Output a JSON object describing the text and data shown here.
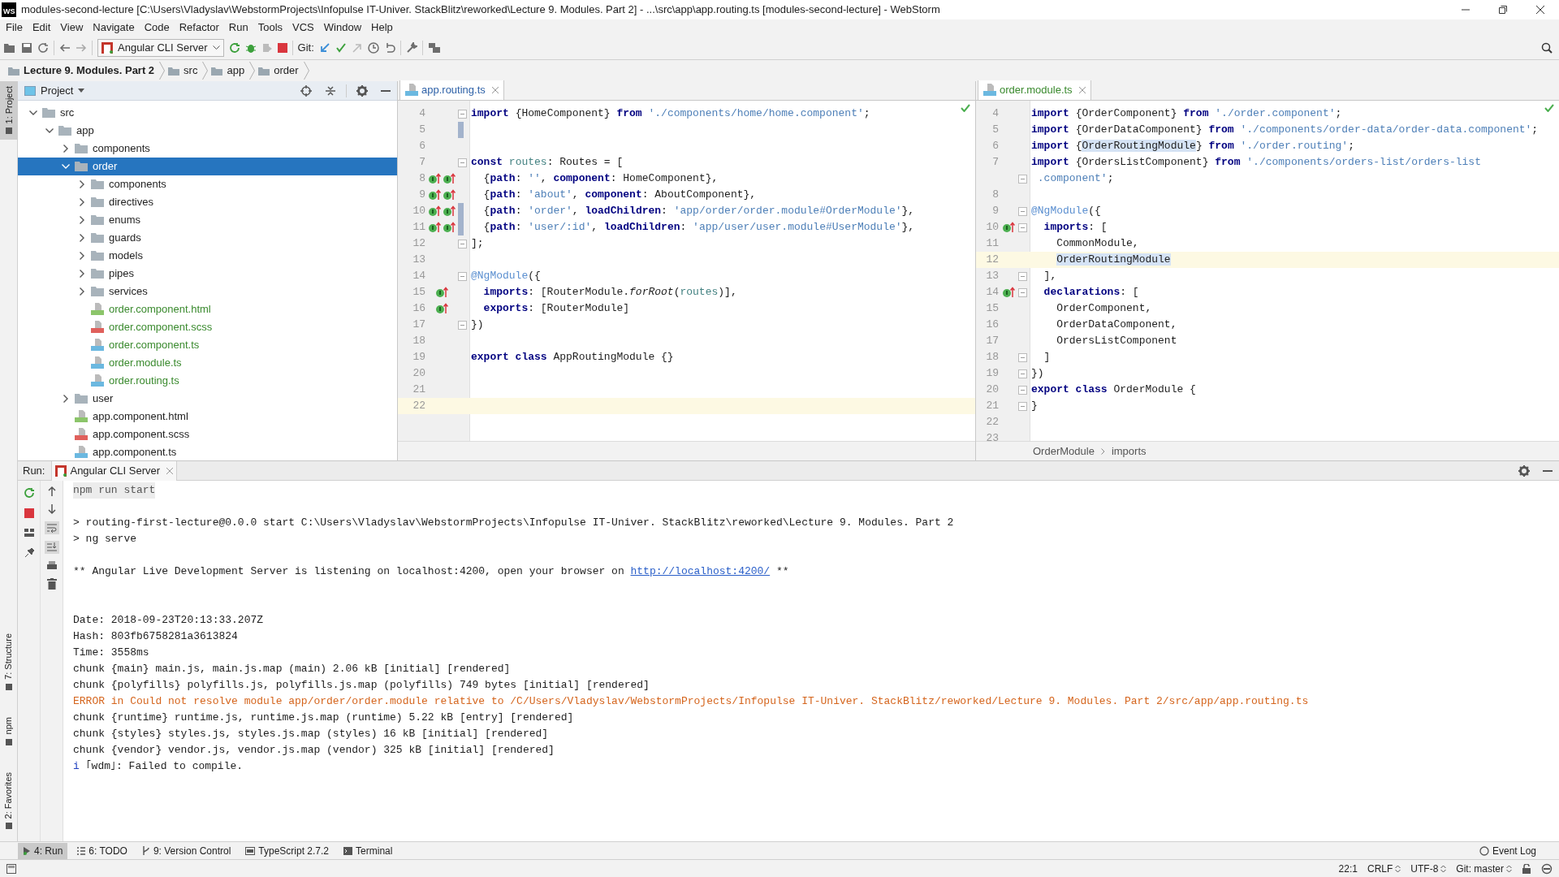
{
  "window": {
    "app_icon": "WS",
    "title": "modules-second-lecture [C:\\Users\\Vladyslav\\WebstormProjects\\Infopulse IT-Univer. StackBlitz\\reworked\\Lecture 9. Modules. Part 2] - ...\\src\\app\\app.routing.ts [modules-second-lecture] - WebStorm"
  },
  "menu": [
    "File",
    "Edit",
    "View",
    "Navigate",
    "Code",
    "Refactor",
    "Run",
    "Tools",
    "VCS",
    "Window",
    "Help"
  ],
  "toolbar": {
    "run_config": "Angular CLI Server",
    "git_label": "Git:"
  },
  "breadcrumb": [
    {
      "label": "Lecture 9. Modules. Part 2",
      "kind": "project"
    },
    {
      "label": "src",
      "kind": "folder"
    },
    {
      "label": "app",
      "kind": "folder"
    },
    {
      "label": "order",
      "kind": "folder"
    }
  ],
  "side_tabs": [
    {
      "label": "1: Project",
      "selected": true
    },
    {
      "label": "7: Structure",
      "selected": false
    },
    {
      "label": "npm",
      "selected": false
    },
    {
      "label": "2: Favorites",
      "selected": false
    }
  ],
  "project": {
    "title": "Project",
    "tree": [
      {
        "label": "src",
        "kind": "folder",
        "expanded": true,
        "selected": false,
        "children": [
          {
            "label": "app",
            "kind": "folder",
            "expanded": true,
            "selected": false,
            "children": [
              {
                "label": "components",
                "kind": "folder",
                "expanded": false,
                "selected": false
              },
              {
                "label": "order",
                "kind": "folder",
                "expanded": true,
                "selected": true,
                "children": [
                  {
                    "label": "components",
                    "kind": "folder",
                    "expanded": false,
                    "selected": false
                  },
                  {
                    "label": "directives",
                    "kind": "folder",
                    "expanded": false,
                    "selected": false
                  },
                  {
                    "label": "enums",
                    "kind": "folder",
                    "expanded": false,
                    "selected": false
                  },
                  {
                    "label": "guards",
                    "kind": "folder",
                    "expanded": false,
                    "selected": false
                  },
                  {
                    "label": "models",
                    "kind": "folder",
                    "expanded": false,
                    "selected": false
                  },
                  {
                    "label": "pipes",
                    "kind": "folder",
                    "expanded": false,
                    "selected": false
                  },
                  {
                    "label": "services",
                    "kind": "folder",
                    "expanded": false,
                    "selected": false
                  },
                  {
                    "label": "order.component.html",
                    "kind": "html",
                    "selected": false,
                    "added": true
                  },
                  {
                    "label": "order.component.scss",
                    "kind": "scss",
                    "selected": false,
                    "added": true
                  },
                  {
                    "label": "order.component.ts",
                    "kind": "ts",
                    "selected": false,
                    "added": true
                  },
                  {
                    "label": "order.module.ts",
                    "kind": "ts",
                    "selected": false,
                    "added": true
                  },
                  {
                    "label": "order.routing.ts",
                    "kind": "ts",
                    "selected": false,
                    "added": true
                  }
                ]
              },
              {
                "label": "user",
                "kind": "folder",
                "expanded": false,
                "selected": false
              },
              {
                "label": "app.component.html",
                "kind": "html",
                "selected": false,
                "added": false
              },
              {
                "label": "app.component.scss",
                "kind": "scss",
                "selected": false,
                "added": false
              },
              {
                "label": "app.component.ts",
                "kind": "ts",
                "selected": false,
                "added": false
              }
            ]
          }
        ]
      }
    ]
  },
  "editors": [
    {
      "tab": {
        "label": "app.routing.ts",
        "kind": "modified"
      },
      "lines": [
        {
          "n": "4",
          "fold": true,
          "tokens": [
            {
              "t": "import",
              "kind": "kw"
            },
            {
              "t": " {HomeComponent} ",
              "kind": "plain"
            },
            {
              "t": "from",
              "kind": "kw"
            },
            {
              "t": " './components/home/home.component'",
              "kind": "str"
            },
            {
              "t": ";",
              "kind": "plain"
            }
          ]
        },
        {
          "n": "5",
          "changed": true
        },
        {
          "n": "6"
        },
        {
          "n": "7",
          "fold": true,
          "tokens": [
            {
              "t": "const",
              "kind": "kw"
            },
            {
              "t": " routes",
              "kind": "var"
            },
            {
              "t": ": Routes = [",
              "kind": "plain"
            }
          ]
        },
        {
          "n": "8",
          "markers": [
            {
              "kind": "implemented"
            },
            {
              "kind": "implemented"
            }
          ],
          "tokens": [
            {
              "t": "  {",
              "kind": "plain"
            },
            {
              "t": "path",
              "kind": "kw"
            },
            {
              "t": ": ",
              "kind": "plain"
            },
            {
              "t": "''",
              "kind": "str"
            },
            {
              "t": ", ",
              "kind": "plain"
            },
            {
              "t": "component",
              "kind": "kw"
            },
            {
              "t": ": HomeComponent},",
              "kind": "plain"
            }
          ]
        },
        {
          "n": "9",
          "markers": [
            {
              "kind": "implemented"
            },
            {
              "kind": "implemented"
            }
          ],
          "tokens": [
            {
              "t": "  {",
              "kind": "plain"
            },
            {
              "t": "path",
              "kind": "kw"
            },
            {
              "t": ": ",
              "kind": "plain"
            },
            {
              "t": "'about'",
              "kind": "str"
            },
            {
              "t": ", ",
              "kind": "plain"
            },
            {
              "t": "component",
              "kind": "kw"
            },
            {
              "t": ": AboutComponent},",
              "kind": "plain"
            }
          ]
        },
        {
          "n": "10",
          "changed": true,
          "markers": [
            {
              "kind": "implemented"
            },
            {
              "kind": "implemented"
            }
          ],
          "tokens": [
            {
              "t": "  {",
              "kind": "plain"
            },
            {
              "t": "path",
              "kind": "kw"
            },
            {
              "t": ": ",
              "kind": "plain"
            },
            {
              "t": "'order'",
              "kind": "str"
            },
            {
              "t": ", ",
              "kind": "plain"
            },
            {
              "t": "loadChildren",
              "kind": "kw"
            },
            {
              "t": ": ",
              "kind": "plain"
            },
            {
              "t": "'app/order/order.module#OrderModule'",
              "kind": "str"
            },
            {
              "t": "},",
              "kind": "plain"
            }
          ]
        },
        {
          "n": "11",
          "changed": true,
          "markers": [
            {
              "kind": "implemented"
            },
            {
              "kind": "implemented"
            }
          ],
          "tokens": [
            {
              "t": "  {",
              "kind": "plain"
            },
            {
              "t": "path",
              "kind": "kw"
            },
            {
              "t": ": ",
              "kind": "plain"
            },
            {
              "t": "'user/:id'",
              "kind": "str"
            },
            {
              "t": ", ",
              "kind": "plain"
            },
            {
              "t": "loadChildren",
              "kind": "kw"
            },
            {
              "t": ": ",
              "kind": "plain"
            },
            {
              "t": "'app/user/user.module#UserModule'",
              "kind": "str"
            },
            {
              "t": "},",
              "kind": "plain"
            }
          ]
        },
        {
          "n": "12",
          "fold": true,
          "tokens": [
            {
              "t": "];",
              "kind": "plain"
            }
          ]
        },
        {
          "n": "13"
        },
        {
          "n": "14",
          "fold": true,
          "tokens": [
            {
              "t": "@NgModule",
              "kind": "dec"
            },
            {
              "t": "({",
              "kind": "plain"
            }
          ]
        },
        {
          "n": "15",
          "markers": [
            {
              "kind": "implemented"
            }
          ],
          "tokens": [
            {
              "t": "  imports",
              "kind": "kw"
            },
            {
              "t": ": [RouterModule.",
              "kind": "plain"
            },
            {
              "t": "forRoot",
              "kind": "it"
            },
            {
              "t": "(",
              "kind": "plain"
            },
            {
              "t": "routes",
              "kind": "var"
            },
            {
              "t": ")],",
              "kind": "plain"
            }
          ]
        },
        {
          "n": "16",
          "markers": [
            {
              "kind": "implemented"
            }
          ],
          "tokens": [
            {
              "t": "  exports",
              "kind": "kw"
            },
            {
              "t": ": [RouterModule]",
              "kind": "plain"
            }
          ]
        },
        {
          "n": "17",
          "fold": true,
          "tokens": [
            {
              "t": "})",
              "kind": "plain"
            }
          ]
        },
        {
          "n": "18"
        },
        {
          "n": "19",
          "tokens": [
            {
              "t": "export class",
              "kind": "kw"
            },
            {
              "t": " AppRoutingModule {}",
              "kind": "plain"
            }
          ]
        },
        {
          "n": "20"
        },
        {
          "n": "21"
        },
        {
          "n": "22",
          "current": true
        }
      ]
    },
    {
      "tab": {
        "label": "order.module.ts",
        "kind": "added"
      },
      "breadcrumb": [
        "OrderModule",
        "imports"
      ],
      "lines": [
        {
          "n": "4",
          "tokens": [
            {
              "t": "import",
              "kind": "kw"
            },
            {
              "t": " {OrderComponent} ",
              "kind": "plain"
            },
            {
              "t": "from",
              "kind": "kw"
            },
            {
              "t": " './order.component'",
              "kind": "str"
            },
            {
              "t": ";",
              "kind": "plain"
            }
          ]
        },
        {
          "n": "5",
          "tokens": [
            {
              "t": "import",
              "kind": "kw"
            },
            {
              "t": " {OrderDataComponent} ",
              "kind": "plain"
            },
            {
              "t": "from",
              "kind": "kw"
            },
            {
              "t": " './components/order-data/order-data.component'",
              "kind": "str"
            },
            {
              "t": ";",
              "kind": "plain"
            }
          ]
        },
        {
          "n": "6",
          "tokens": [
            {
              "t": "import",
              "kind": "kw"
            },
            {
              "t": " {",
              "kind": "plain"
            },
            {
              "t": "OrderRoutingModule",
              "kind": "hl"
            },
            {
              "t": "} ",
              "kind": "plain"
            },
            {
              "t": "from",
              "kind": "kw"
            },
            {
              "t": " './order.routing'",
              "kind": "str"
            },
            {
              "t": ";",
              "kind": "plain"
            }
          ]
        },
        {
          "n": "7",
          "tokens": [
            {
              "t": "import",
              "kind": "kw"
            },
            {
              "t": " {OrdersListComponent} ",
              "kind": "plain"
            },
            {
              "t": "from",
              "kind": "kw"
            },
            {
              "t": " './components/orders-list/orders-list",
              "kind": "str"
            }
          ]
        },
        {
          "fold": true,
          "tokens": [
            {
              "t": " .component'",
              "kind": "str"
            },
            {
              "t": ";",
              "kind": "plain"
            }
          ]
        },
        {
          "n": "8"
        },
        {
          "n": "9",
          "fold": true,
          "tokens": [
            {
              "t": "@NgModule",
              "kind": "dec"
            },
            {
              "t": "({",
              "kind": "plain"
            }
          ]
        },
        {
          "n": "10",
          "fold": true,
          "markers": [
            {
              "kind": "implemented"
            }
          ],
          "tokens": [
            {
              "t": "  imports",
              "kind": "kw"
            },
            {
              "t": ": [",
              "kind": "plain"
            }
          ]
        },
        {
          "n": "11",
          "tokens": [
            {
              "t": "    CommonModule,",
              "kind": "plain"
            }
          ]
        },
        {
          "n": "12",
          "current": true,
          "tokens": [
            {
              "t": "    OrderRoutingModule",
              "kind": "hl"
            }
          ]
        },
        {
          "n": "13",
          "fold": true,
          "tokens": [
            {
              "t": "  ],",
              "kind": "plain"
            }
          ]
        },
        {
          "n": "14",
          "fold": true,
          "markers": [
            {
              "kind": "implemented"
            }
          ],
          "tokens": [
            {
              "t": "  declarations",
              "kind": "kw"
            },
            {
              "t": ": [",
              "kind": "plain"
            }
          ]
        },
        {
          "n": "15",
          "tokens": [
            {
              "t": "    OrderComponent,",
              "kind": "plain"
            }
          ]
        },
        {
          "n": "16",
          "tokens": [
            {
              "t": "    OrderDataComponent,",
              "kind": "plain"
            }
          ]
        },
        {
          "n": "17",
          "tokens": [
            {
              "t": "    OrdersListComponent",
              "kind": "plain"
            }
          ]
        },
        {
          "n": "18",
          "fold": true,
          "tokens": [
            {
              "t": "  ]",
              "kind": "plain"
            }
          ]
        },
        {
          "n": "19",
          "fold": true,
          "tokens": [
            {
              "t": "})",
              "kind": "plain"
            }
          ]
        },
        {
          "n": "20",
          "fold": true,
          "tokens": [
            {
              "t": "export class",
              "kind": "kw"
            },
            {
              "t": " OrderModule {",
              "kind": "plain"
            }
          ]
        },
        {
          "n": "21",
          "fold": true,
          "tokens": [
            {
              "t": "}",
              "kind": "plain"
            }
          ]
        },
        {
          "n": "22"
        },
        {
          "n": "23"
        }
      ]
    }
  ],
  "run": {
    "label": "Run:",
    "tab": "Angular CLI Server",
    "console": [
      {
        "kind": "command",
        "segments": [
          {
            "t": "npm run start",
            "kind": "plain"
          }
        ]
      },
      {
        "kind": "blank"
      },
      {
        "kind": "text",
        "segments": [
          {
            "t": "> routing-first-lecture@0.0.0 start C:\\Users\\Vladyslav\\WebstormProjects\\Infopulse IT-Univer. StackBlitz\\reworked\\Lecture 9. Modules. Part 2",
            "kind": "plain"
          }
        ]
      },
      {
        "kind": "text",
        "segments": [
          {
            "t": "> ng serve",
            "kind": "plain"
          }
        ]
      },
      {
        "kind": "blank"
      },
      {
        "kind": "text",
        "segments": [
          {
            "t": "** Angular Live Development Server is listening on localhost:4200, open your browser on ",
            "kind": "plain"
          },
          {
            "t": "http://localhost:4200/",
            "kind": "link"
          },
          {
            "t": " **",
            "kind": "plain"
          }
        ]
      },
      {
        "kind": "blank"
      },
      {
        "kind": "blank"
      },
      {
        "kind": "text",
        "segments": [
          {
            "t": "Date: 2018-09-23T20:13:33.207Z",
            "kind": "plain"
          }
        ]
      },
      {
        "kind": "text",
        "segments": [
          {
            "t": "Hash: 803fb6758281a3613824",
            "kind": "plain"
          }
        ]
      },
      {
        "kind": "text",
        "segments": [
          {
            "t": "Time: 3558ms",
            "kind": "plain"
          }
        ]
      },
      {
        "kind": "text",
        "segments": [
          {
            "t": "chunk {main} main.js, main.js.map (main) 2.06 kB [initial] [rendered]",
            "kind": "plain"
          }
        ]
      },
      {
        "kind": "text",
        "segments": [
          {
            "t": "chunk {polyfills} polyfills.js, polyfills.js.map (polyfills) 749 bytes [initial] [rendered]",
            "kind": "plain"
          }
        ]
      },
      {
        "kind": "text",
        "segments": [
          {
            "t": "ERROR in Could not resolve module app/order/order.module relative to /C/Users/Vladyslav/WebstormProjects/Infopulse IT-Univer. StackBlitz/reworked/Lecture 9. Modules. Part 2/src/app/app.routing.ts",
            "kind": "error"
          }
        ]
      },
      {
        "kind": "text",
        "segments": [
          {
            "t": "chunk {runtime} runtime.js, runtime.js.map (runtime) 5.22 kB [entry] [rendered]",
            "kind": "plain"
          }
        ]
      },
      {
        "kind": "text",
        "segments": [
          {
            "t": "chunk {styles} styles.js, styles.js.map (styles) 16 kB [initial] [rendered]",
            "kind": "plain"
          }
        ]
      },
      {
        "kind": "text",
        "segments": [
          {
            "t": "chunk {vendor} vendor.js, vendor.js.map (vendor) 325 kB [initial] [rendered]",
            "kind": "plain"
          }
        ]
      },
      {
        "kind": "text",
        "segments": [
          {
            "t": "i",
            "kind": "info"
          },
          {
            "t": " ｢wdm｣: Failed to compile.",
            "kind": "plain"
          }
        ]
      }
    ]
  },
  "tool_tabs": [
    {
      "label": "4: Run",
      "selected": true
    },
    {
      "label": "6: TODO",
      "selected": false
    },
    {
      "label": "9: Version Control",
      "selected": false
    },
    {
      "label": "TypeScript 2.7.2",
      "selected": false
    },
    {
      "label": "Terminal",
      "selected": false
    }
  ],
  "event_log": "Event Log",
  "status_bar": {
    "position": "22:1",
    "line_separator": "CRLF",
    "encoding": "UTF-8",
    "branch": "Git: master"
  }
}
